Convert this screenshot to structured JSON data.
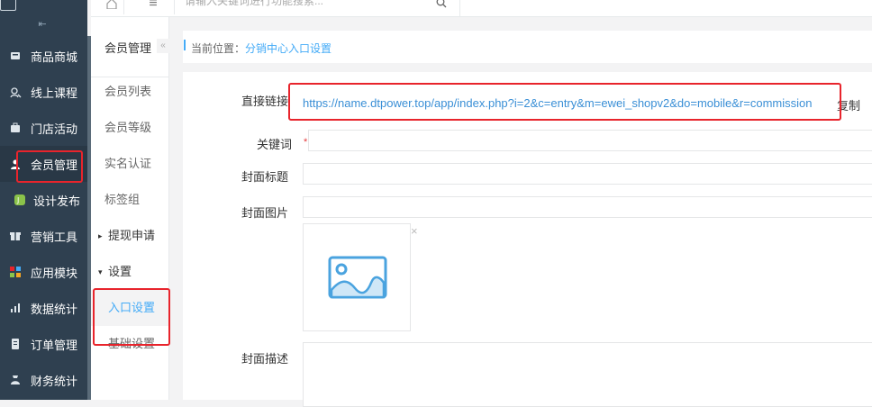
{
  "sidebar": {
    "items": [
      {
        "label": "商品商城",
        "icon": "mall-icon"
      },
      {
        "label": "线上课程",
        "icon": "course-icon"
      },
      {
        "label": "门店活动",
        "icon": "store-icon"
      },
      {
        "label": "会员管理",
        "icon": "member-icon",
        "active": true
      },
      {
        "label": "设计发布",
        "icon": "design-icon"
      },
      {
        "label": "营销工具",
        "icon": "gift-icon"
      },
      {
        "label": "应用模块",
        "icon": "apps-icon"
      },
      {
        "label": "数据统计",
        "icon": "chart-icon"
      },
      {
        "label": "订单管理",
        "icon": "order-icon"
      },
      {
        "label": "财务统计",
        "icon": "finance-icon"
      }
    ]
  },
  "topbar": {
    "search_placeholder": "请输入关键词进行功能搜索..."
  },
  "subnav": {
    "title": "会员管理",
    "items": [
      {
        "label": "会员列表"
      },
      {
        "label": "会员等级"
      },
      {
        "label": "实名认证"
      },
      {
        "label": "标签组"
      },
      {
        "label": "提现申请",
        "group": true,
        "caret": "▸"
      },
      {
        "label": "设置",
        "group": true,
        "caret": "▾"
      },
      {
        "label": "入口设置",
        "active": true
      },
      {
        "label": "基础设置"
      }
    ]
  },
  "breadcrumb": {
    "label": "当前位置：",
    "current": "分销中心入口设置"
  },
  "form": {
    "direct_link_label": "直接链接",
    "direct_link_value": "https://name.dtpower.top/app/index.php?i=2&c=entry&m=ewei_shopv2&do=mobile&r=commission",
    "direct_link_tail": "复制",
    "keyword_label": "关键词",
    "required_mark": "*",
    "cover_title_label": "封面标题",
    "cover_image_label": "封面图片",
    "cover_desc_label": "封面描述",
    "remove_symbol": "×"
  },
  "colors": {
    "sidebar_bg": "#2f4050",
    "accent": "#44abf7",
    "highlight_border": "#e8242c"
  }
}
